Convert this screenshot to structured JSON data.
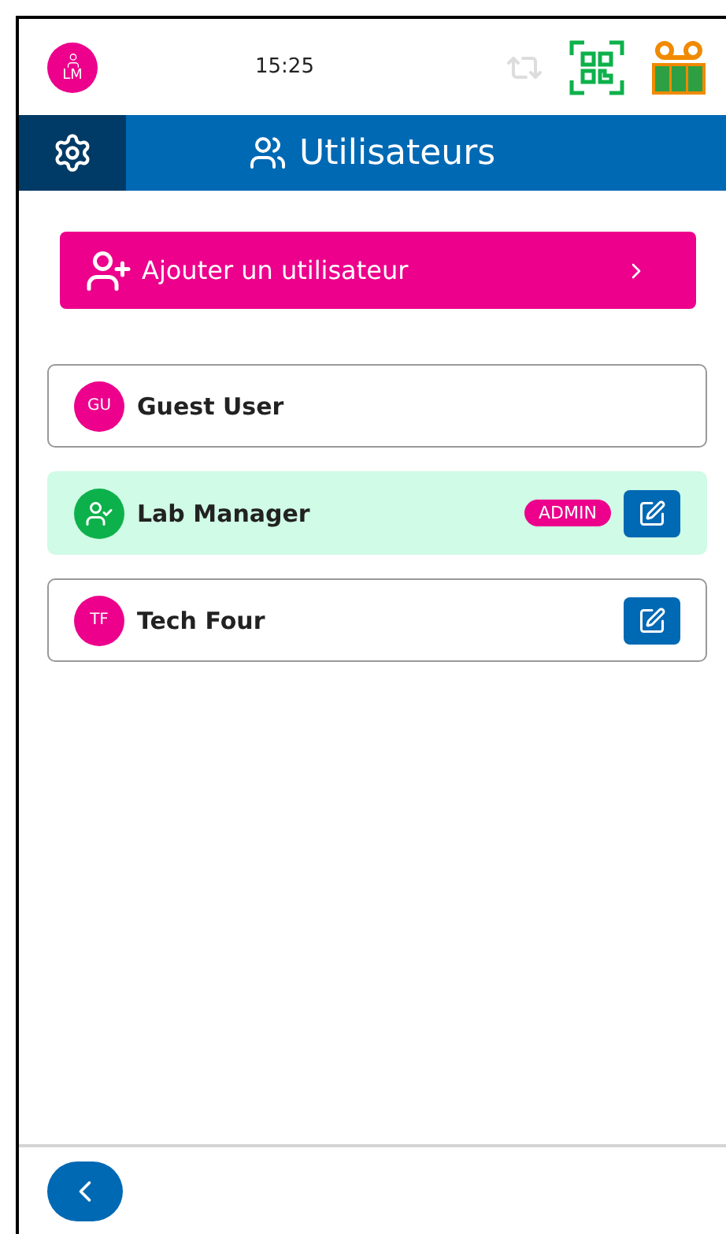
{
  "status_bar": {
    "avatar_initials": "LM",
    "time": "15:25"
  },
  "title_bar": {
    "title": "Utilisateurs"
  },
  "add_button": {
    "label": "Ajouter un utilisateur"
  },
  "users": [
    {
      "kind": "initials",
      "initials": "GU",
      "name": "Guest User",
      "selected": false,
      "editable": false
    },
    {
      "kind": "current",
      "name": "Lab Manager",
      "selected": true,
      "badge": "ADMIN",
      "editable": true
    },
    {
      "kind": "initials",
      "initials": "TF",
      "name": "Tech Four",
      "selected": false,
      "editable": true
    }
  ]
}
